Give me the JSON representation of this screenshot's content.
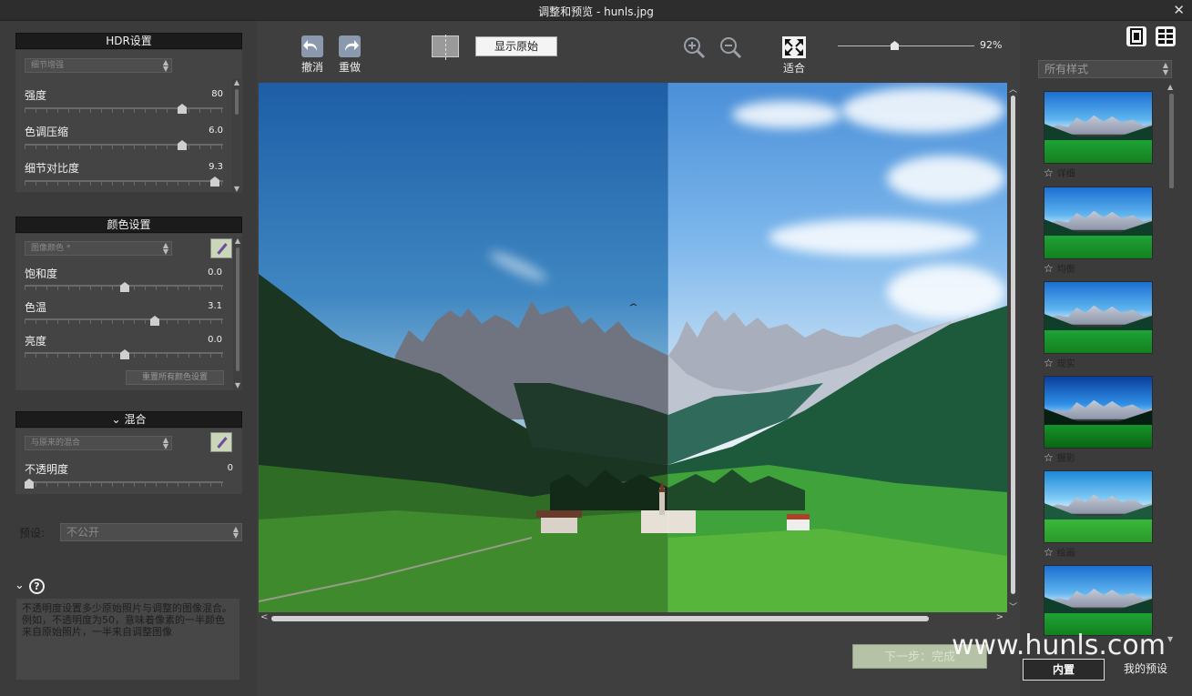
{
  "window": {
    "title": "调整和预览 - hunls.jpg",
    "close_label": "✕"
  },
  "hdr": {
    "header": "HDR设置",
    "mode": "细节增强",
    "sliders": [
      {
        "label": "强度",
        "value": "80",
        "level": 0.8
      },
      {
        "label": "色调压缩",
        "value": "6.0",
        "level": 0.8
      },
      {
        "label": "细节对比度",
        "value": "9.3",
        "level": 0.95
      }
    ]
  },
  "color": {
    "header": "颜色设置",
    "mode": "图像颜色 *",
    "sliders": [
      {
        "label": "饱和度",
        "value": "0.0",
        "level": 0.5
      },
      {
        "label": "色温",
        "value": "3.1",
        "level": 0.65
      },
      {
        "label": "亮度",
        "value": "0.0",
        "level": 0.5
      }
    ],
    "reset_label": "重置所有颜色设置"
  },
  "blend": {
    "header": "混合",
    "header_icon": "⌄",
    "mode": "与原来的混合",
    "opacity_label": "不透明度",
    "opacity_value": "0",
    "opacity_level": 0.0
  },
  "preset": {
    "label": "预设:",
    "value": "不公开"
  },
  "help": {
    "collapse_icon": "⌄",
    "icon": "?",
    "text": "不透明度设置多少原始照片与调整的图像混合。例如，不透明度为50，意味着像素的一半颜色来自原始照片，一半来自调整图像"
  },
  "toolbar": {
    "undo": "撤消",
    "redo": "重做",
    "show_original": "显示原始",
    "fit": "适合",
    "zoom": "92%",
    "zoom_level": 0.42
  },
  "next_button": "下一步：完成",
  "styles": {
    "filter": "所有样式",
    "items": [
      {
        "label": "详细"
      },
      {
        "label": "均衡"
      },
      {
        "label": "现实"
      },
      {
        "label": "摄影"
      },
      {
        "label": "绘画"
      },
      {
        "label": ""
      }
    ],
    "tabs": [
      "内置",
      "我的预设"
    ]
  },
  "watermark": "www.hunls.com",
  "colors": {
    "accent": "#b5c2a6",
    "header_bg": "#1b1b1b",
    "panel_bg": "#3b3b3b"
  }
}
